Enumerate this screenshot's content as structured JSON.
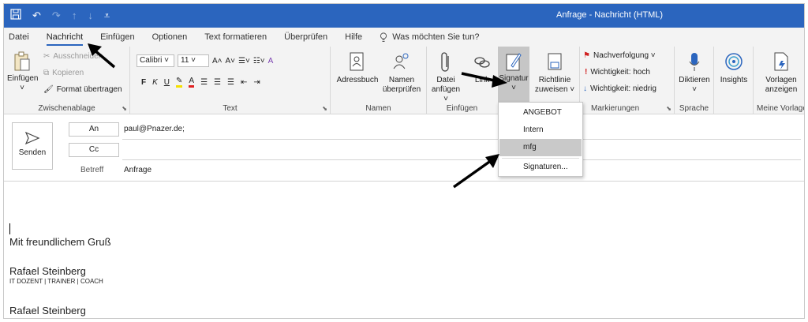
{
  "window": {
    "title": "Anfrage - Nachricht (HTML)"
  },
  "tabs": [
    {
      "label": "Datei"
    },
    {
      "label": "Nachricht"
    },
    {
      "label": "Einfügen"
    },
    {
      "label": "Optionen"
    },
    {
      "label": "Text formatieren"
    },
    {
      "label": "Überprüfen"
    },
    {
      "label": "Hilfe"
    }
  ],
  "tellme": "Was möchten Sie tun?",
  "ribbon": {
    "clipboard": {
      "paste": "Einfügen",
      "cut": "Ausschneiden",
      "copy": "Kopieren",
      "format": "Format übertragen",
      "label": "Zwischenablage"
    },
    "text": {
      "font": "Calibri",
      "size": "11",
      "bold": "F",
      "italic": "K",
      "underline": "U",
      "label": "Text"
    },
    "names": {
      "addressbook": "Adressbuch",
      "check_line1": "Namen",
      "check_line2": "überprüfen",
      "label": "Namen"
    },
    "insert": {
      "file_line1": "Datei",
      "file_line2": "anfügen ˅",
      "link": "Link",
      "signature": "Signatur",
      "label": "Einfügen"
    },
    "policy": {
      "line1": "Richtlinie",
      "line2": "zuweisen ˅"
    },
    "tags": {
      "followup": "Nachverfolgung ˅",
      "high": "Wichtigkeit: hoch",
      "low": "Wichtigkeit: niedrig",
      "label": "Markierungen"
    },
    "voice": {
      "dictate": "Diktieren",
      "label": "Sprache"
    },
    "insights": {
      "label": "Insights"
    },
    "templates": {
      "line1": "Vorlagen",
      "line2": "anzeigen",
      "label": "Meine Vorlagen"
    }
  },
  "compose": {
    "send": "Senden",
    "to_label": "An",
    "to_value": "paul@Pnazer.de;",
    "cc_label": "Cc",
    "cc_value": "",
    "subject_label": "Betreff",
    "subject_value": "Anfrage"
  },
  "body": {
    "greeting": "Mit freundlichem Gruß",
    "sig_name": "Rafael Steinberg",
    "sig_title": "IT DOZENT | TRAINER | COACH",
    "sig_name2": "Rafael Steinberg"
  },
  "signature_menu": {
    "items": [
      "ANGEBOT",
      "Intern",
      "mfg",
      "Signaturen..."
    ],
    "highlighted": "mfg"
  },
  "colors": {
    "titlebar": "#2b65be",
    "accent": "#2b65be",
    "highlight": "#c9c9c9"
  }
}
